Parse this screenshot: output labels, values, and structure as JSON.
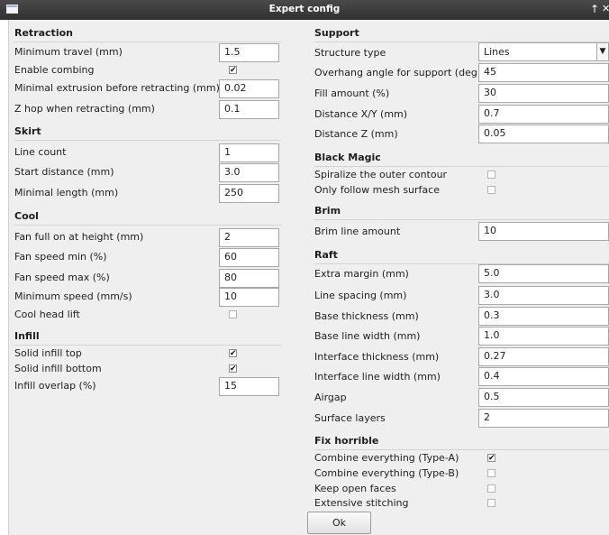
{
  "window": {
    "title": "Expert config",
    "up_glyph": "↑",
    "close_glyph": "✕",
    "icon": "window-app-icon"
  },
  "checkmark": "✔",
  "retraction": {
    "title": "Retraction",
    "min_travel": {
      "label": "Minimum travel (mm)",
      "value": "1.5"
    },
    "enable_combing": {
      "label": "Enable combing",
      "checked": true
    },
    "min_extrusion": {
      "label": "Minimal extrusion before retracting (mm)",
      "value": "0.02"
    },
    "z_hop": {
      "label": "Z hop when retracting (mm)",
      "value": "0.1"
    }
  },
  "skirt": {
    "title": "Skirt",
    "line_count": {
      "label": "Line count",
      "value": "1"
    },
    "start_distance": {
      "label": "Start distance (mm)",
      "value": "3.0"
    },
    "min_length": {
      "label": "Minimal length (mm)",
      "value": "250"
    }
  },
  "cool": {
    "title": "Cool",
    "fan_full_height": {
      "label": "Fan full on at height (mm)",
      "value": "2"
    },
    "fan_speed_min": {
      "label": "Fan speed min (%)",
      "value": "60"
    },
    "fan_speed_max": {
      "label": "Fan speed max (%)",
      "value": "80"
    },
    "min_speed": {
      "label": "Minimum speed (mm/s)",
      "value": "10"
    },
    "cool_head_lift": {
      "label": "Cool head lift",
      "checked": false
    }
  },
  "infill": {
    "title": "Infill",
    "solid_top": {
      "label": "Solid infill top",
      "checked": true
    },
    "solid_bottom": {
      "label": "Solid infill bottom",
      "checked": true
    },
    "overlap": {
      "label": "Infill overlap (%)",
      "value": "15"
    }
  },
  "support": {
    "title": "Support",
    "structure_type": {
      "label": "Structure type",
      "value": "Lines"
    },
    "overhang_angle": {
      "label": "Overhang angle for support (deg)",
      "value": "45"
    },
    "fill_amount": {
      "label": "Fill amount (%)",
      "value": "30"
    },
    "distance_xy": {
      "label": "Distance X/Y (mm)",
      "value": "0.7"
    },
    "distance_z": {
      "label": "Distance Z (mm)",
      "value": "0.05"
    }
  },
  "black_magic": {
    "title": "Black Magic",
    "spiralize": {
      "label": "Spiralize the outer contour",
      "checked": false
    },
    "mesh_surface": {
      "label": "Only follow mesh surface",
      "checked": false
    }
  },
  "brim": {
    "title": "Brim",
    "line_amount": {
      "label": "Brim line amount",
      "value": "10"
    }
  },
  "raft": {
    "title": "Raft",
    "extra_margin": {
      "label": "Extra margin (mm)",
      "value": "5.0"
    },
    "line_spacing": {
      "label": "Line spacing (mm)",
      "value": "3.0"
    },
    "base_thickness": {
      "label": "Base thickness (mm)",
      "value": "0.3"
    },
    "base_line_width": {
      "label": "Base line width (mm)",
      "value": "1.0"
    },
    "interface_thickness": {
      "label": "Interface thickness (mm)",
      "value": "0.27"
    },
    "interface_line_width": {
      "label": "Interface line width (mm)",
      "value": "0.4"
    },
    "airgap": {
      "label": "Airgap",
      "value": "0.5"
    },
    "surface_layers": {
      "label": "Surface layers",
      "value": "2"
    }
  },
  "fix_horrible": {
    "title": "Fix horrible",
    "type_a": {
      "label": "Combine everything (Type-A)",
      "checked": true
    },
    "type_b": {
      "label": "Combine everything (Type-B)",
      "checked": false
    },
    "open_faces": {
      "label": "Keep open faces",
      "checked": false
    },
    "stitching": {
      "label": "Extensive stitching",
      "checked": false
    }
  },
  "ok_label": "Ok"
}
